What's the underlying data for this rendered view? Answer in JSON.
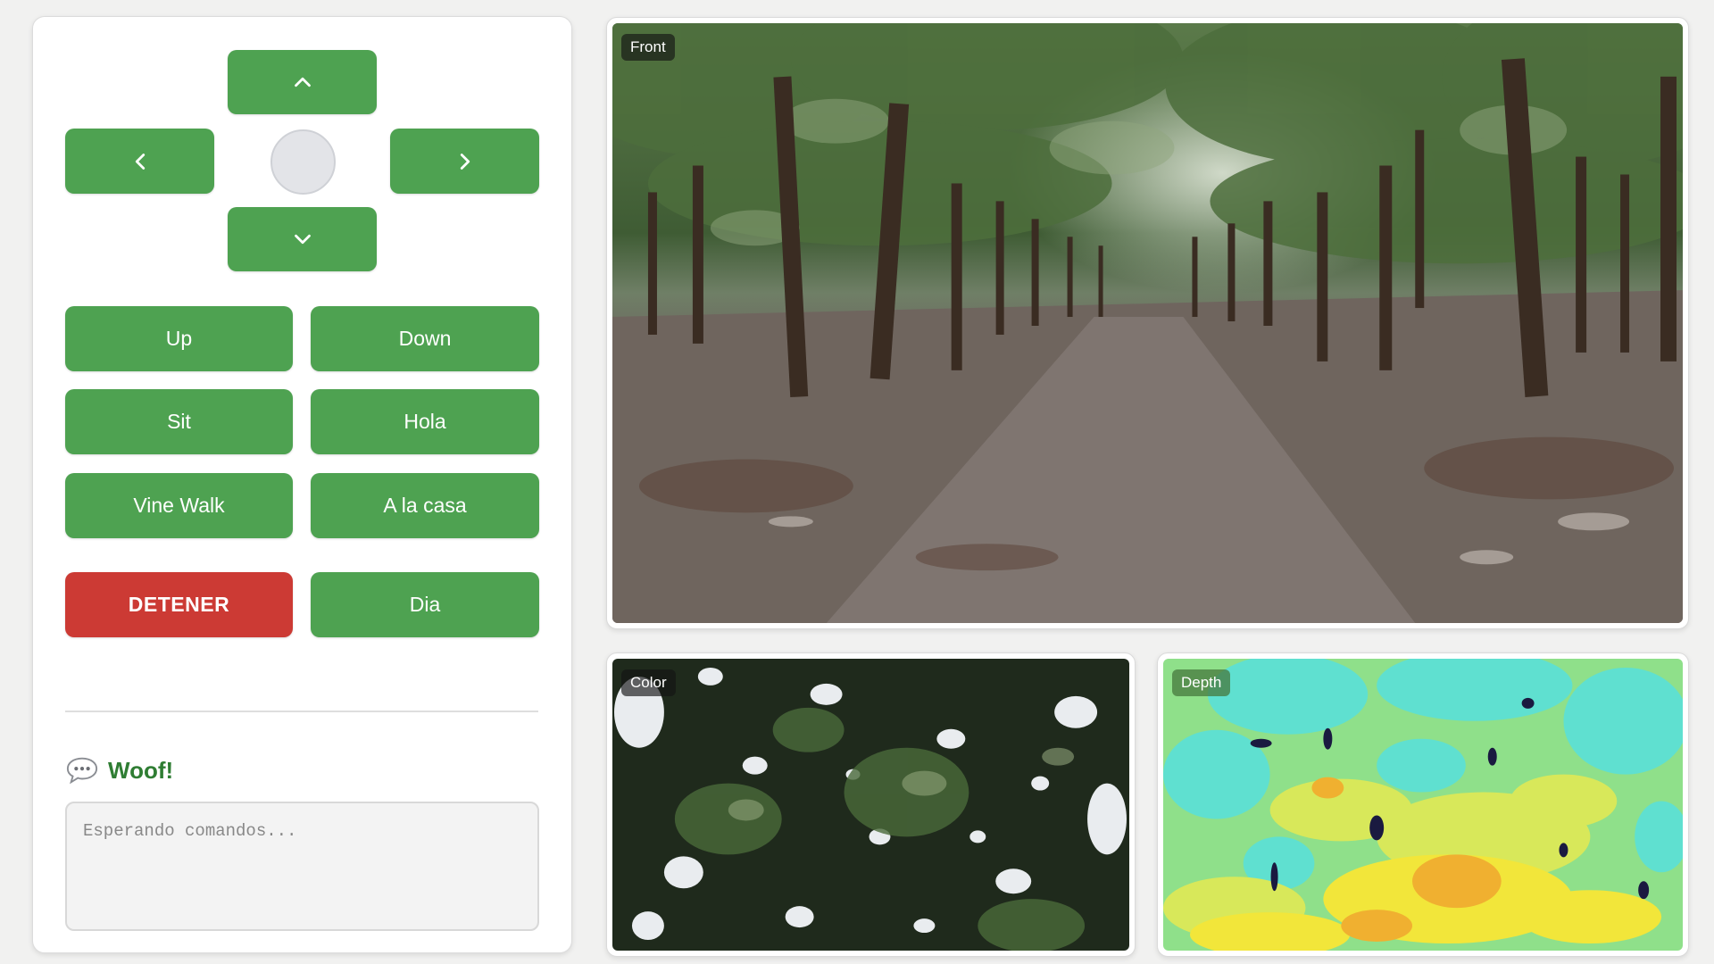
{
  "controls": {
    "dpad": {
      "up_icon": "chevron-up-icon",
      "down_icon": "chevron-down-icon",
      "left_icon": "chevron-left-icon",
      "right_icon": "chevron-right-icon"
    },
    "commands": {
      "up": "Up",
      "down": "Down",
      "sit": "Sit",
      "hola": "Hola",
      "vine_walk": "Vine Walk",
      "a_la_casa": "A la casa",
      "detener": "DETENER",
      "dia": "Dia"
    }
  },
  "messages": {
    "icon": "speech-bubble-icon",
    "title": "Woof!",
    "placeholder": "Esperando comandos..."
  },
  "cameras": {
    "front": "Front",
    "color": "Color",
    "depth": "Depth"
  },
  "colors": {
    "button_green": "#4ea251",
    "stop_red": "#cc3a34",
    "title_green": "#2f7d33",
    "background": "#f1f1f0"
  }
}
